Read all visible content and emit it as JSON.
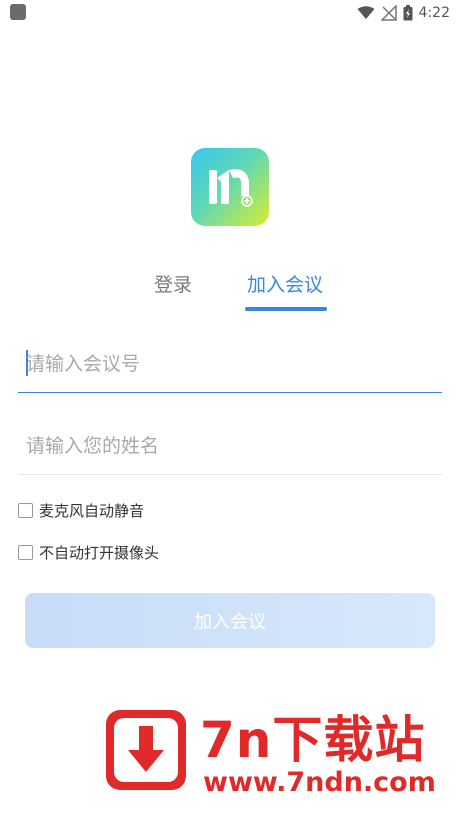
{
  "status_bar": {
    "time": "4:22",
    "icons": [
      "app-notification-icon",
      "wifi-icon",
      "signal-off-icon",
      "battery-charging-icon"
    ]
  },
  "app": {
    "logo_icon": "meeting-app-logo-icon",
    "logo_colors": [
      "#39c6ee",
      "#5fd8b5",
      "#d9ee2e"
    ]
  },
  "tabs": [
    {
      "label": "登录",
      "active": false
    },
    {
      "label": "加入会议",
      "active": true
    }
  ],
  "form": {
    "meeting_id": {
      "value": "",
      "placeholder": "请输入会议号"
    },
    "name": {
      "value": "",
      "placeholder": "请输入您的姓名"
    },
    "options": [
      {
        "label": "麦克风自动静音",
        "checked": false
      },
      {
        "label": "不自动打开摄像头",
        "checked": false
      }
    ],
    "submit_label": "加入会议"
  },
  "watermark": {
    "title": "7n下载站",
    "url": "www.7ndn.com",
    "icon": "download-arrow-icon",
    "color": "#e02a2a"
  },
  "colors": {
    "accent": "#3b87e0",
    "button_bg": "#c7dcf7"
  }
}
